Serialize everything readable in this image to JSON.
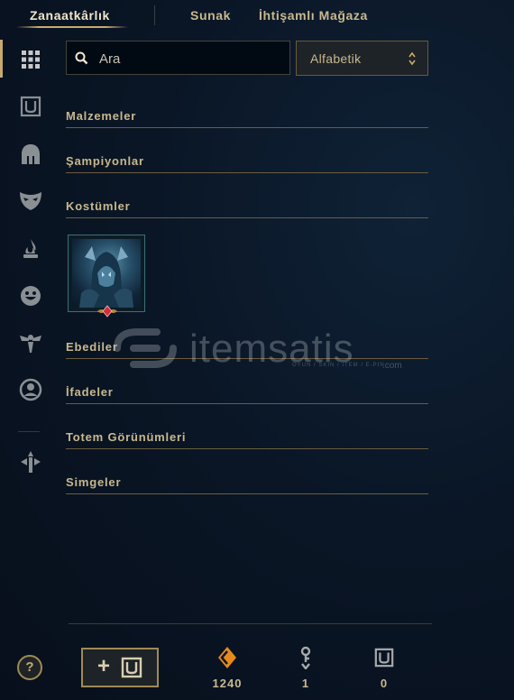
{
  "nav": {
    "tabs": [
      {
        "label": "Zanaatkârlık",
        "active": true
      },
      {
        "label": "Sunak"
      },
      {
        "label": "İhtişamlı Mağaza"
      }
    ]
  },
  "sidebar": {
    "items": [
      {
        "icon": "grid-icon",
        "active": true
      },
      {
        "icon": "chest-icon"
      },
      {
        "icon": "helmet-icon"
      },
      {
        "icon": "mask-icon"
      },
      {
        "icon": "flame-icon"
      },
      {
        "icon": "smiley-icon"
      },
      {
        "icon": "ward-icon"
      },
      {
        "icon": "profile-icon"
      },
      {
        "icon": "arrows-icon"
      }
    ]
  },
  "search": {
    "placeholder": "Ara",
    "value": ""
  },
  "sort": {
    "selected": "Alfabetik"
  },
  "sections": {
    "materials": "Malzemeler",
    "champions": "Şampiyonlar",
    "skins": "Kostümler",
    "eternals": "Ebediler",
    "emotes": "İfadeler",
    "ward_skins": "Totem Görünümleri",
    "icons": "Simgeler"
  },
  "watermark": {
    "text": "itemsatis",
    "suffix": ".com",
    "tagline": "OYUN / SKIN / ITEM / E-PIN"
  },
  "footer": {
    "help_label": "?",
    "add_label": "+",
    "currencies": [
      {
        "icon": "orange-essence-icon",
        "value": "1240",
        "color": "#e8891d"
      },
      {
        "icon": "key-icon",
        "value": "1"
      },
      {
        "icon": "chest-icon",
        "value": "0"
      }
    ]
  },
  "colors": {
    "accent": "#c8aa6e",
    "background": "#0a1626"
  }
}
